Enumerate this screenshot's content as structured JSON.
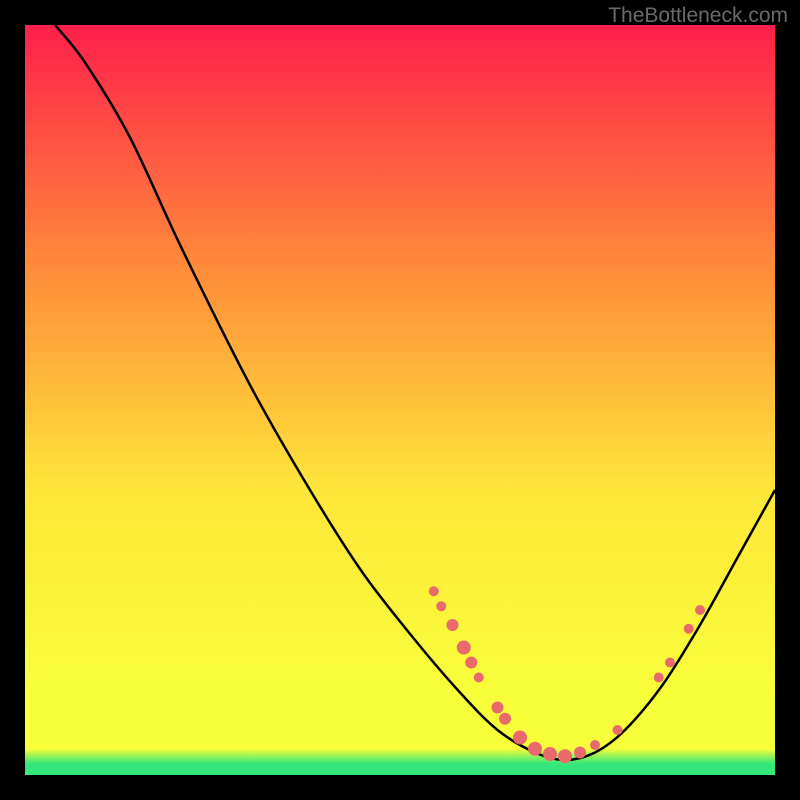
{
  "watermark": "TheBottleneck.com",
  "colors": {
    "gradient_top": "#ff1f4b",
    "gradient_mid1": "#ff8a3a",
    "gradient_mid2": "#ffe63a",
    "gradient_bottom_yellow": "#f7ff3a",
    "gradient_green": "#34e77a",
    "curve": "#000000",
    "marker": "#e86a6a",
    "frame": "#000000"
  },
  "chart_data": {
    "type": "line",
    "title": "",
    "xlabel": "",
    "ylabel": "",
    "xlim": [
      0,
      100
    ],
    "ylim": [
      0,
      100
    ],
    "curve": [
      {
        "x": 4,
        "y": 100
      },
      {
        "x": 8,
        "y": 95
      },
      {
        "x": 14,
        "y": 85
      },
      {
        "x": 21,
        "y": 70
      },
      {
        "x": 30,
        "y": 52
      },
      {
        "x": 38,
        "y": 38
      },
      {
        "x": 45,
        "y": 27
      },
      {
        "x": 52,
        "y": 18
      },
      {
        "x": 58,
        "y": 11
      },
      {
        "x": 63,
        "y": 6
      },
      {
        "x": 68,
        "y": 3
      },
      {
        "x": 72,
        "y": 2
      },
      {
        "x": 76,
        "y": 3
      },
      {
        "x": 80,
        "y": 6
      },
      {
        "x": 85,
        "y": 12
      },
      {
        "x": 90,
        "y": 20
      },
      {
        "x": 95,
        "y": 29
      },
      {
        "x": 100,
        "y": 38
      }
    ],
    "markers": [
      {
        "x": 54.5,
        "y": 24.5,
        "r": 5
      },
      {
        "x": 55.5,
        "y": 22.5,
        "r": 5
      },
      {
        "x": 57.0,
        "y": 20.0,
        "r": 6
      },
      {
        "x": 58.5,
        "y": 17.0,
        "r": 7
      },
      {
        "x": 59.5,
        "y": 15.0,
        "r": 6
      },
      {
        "x": 60.5,
        "y": 13.0,
        "r": 5
      },
      {
        "x": 63.0,
        "y": 9.0,
        "r": 6
      },
      {
        "x": 64.0,
        "y": 7.5,
        "r": 6
      },
      {
        "x": 66.0,
        "y": 5.0,
        "r": 7
      },
      {
        "x": 68.0,
        "y": 3.5,
        "r": 7
      },
      {
        "x": 70.0,
        "y": 2.8,
        "r": 7
      },
      {
        "x": 72.0,
        "y": 2.5,
        "r": 7
      },
      {
        "x": 74.0,
        "y": 3.0,
        "r": 6
      },
      {
        "x": 76.0,
        "y": 4.0,
        "r": 5
      },
      {
        "x": 79.0,
        "y": 6.0,
        "r": 5
      },
      {
        "x": 84.5,
        "y": 13.0,
        "r": 5
      },
      {
        "x": 86.0,
        "y": 15.0,
        "r": 5
      },
      {
        "x": 88.5,
        "y": 19.5,
        "r": 5
      },
      {
        "x": 90.0,
        "y": 22.0,
        "r": 5
      }
    ]
  }
}
